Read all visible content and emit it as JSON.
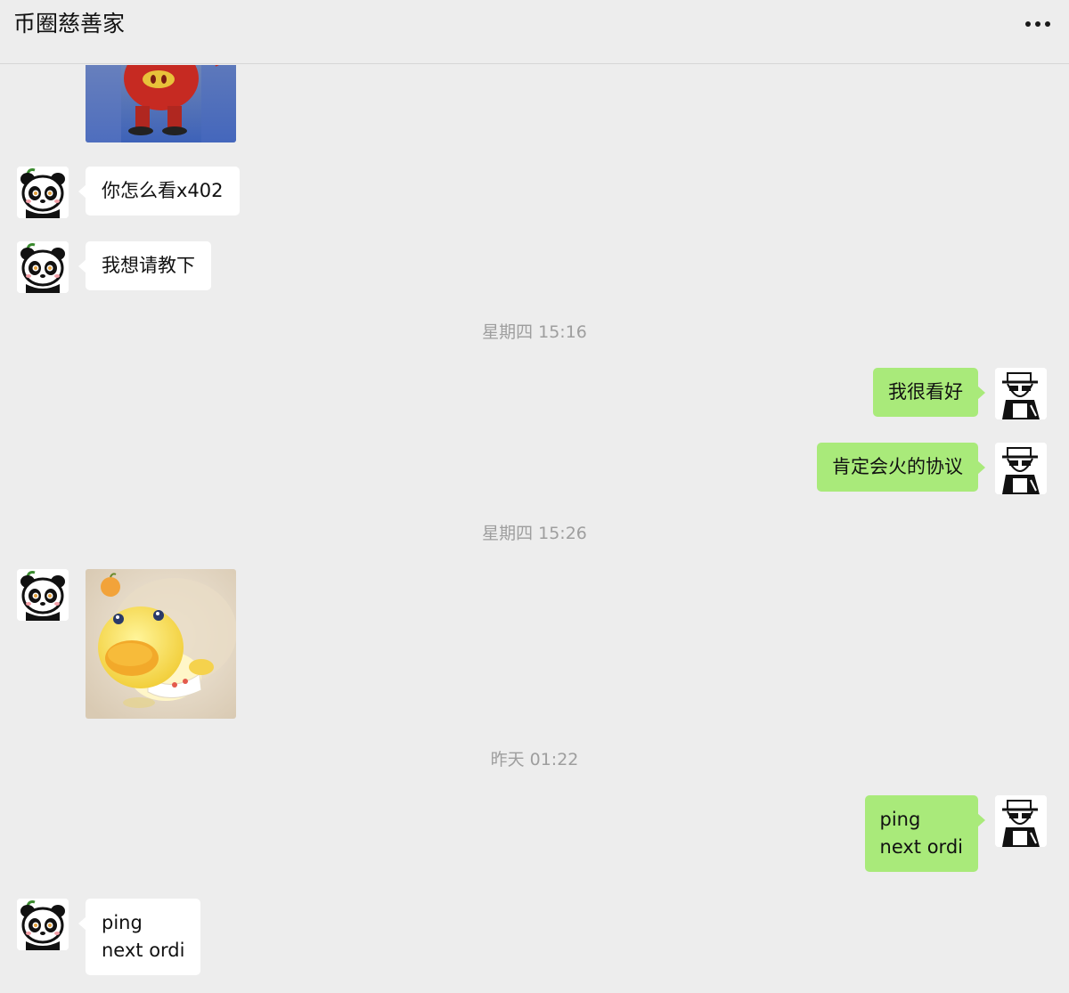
{
  "header": {
    "title": "币圈慈善家",
    "more_icon": "more-dots-icon"
  },
  "messages": {
    "m1": {
      "text": "你怎么看x402"
    },
    "m2": {
      "text": "我想请教下"
    },
    "t1": "星期四 15:16",
    "m3": {
      "text": "我很看好"
    },
    "m4": {
      "text": "肯定会火的协议"
    },
    "t2": "星期四 15:26",
    "t3": "昨天 01:22",
    "m5": {
      "line1": "ping",
      "line2": "next ordi"
    },
    "m6": {
      "line1": "ping",
      "line2": "next ordi"
    }
  },
  "colors": {
    "background": "#ededed",
    "bubble_in": "#ffffff",
    "bubble_out": "#a9ea7a",
    "timestamp": "#9e9e9e"
  },
  "icons": {
    "panda_avatar": "panda-avatar-icon",
    "sketch_avatar": "sketch-avatar-icon",
    "sticker_pig": "red-pig-sticker",
    "sticker_duck": "yellow-duck-sticker"
  }
}
